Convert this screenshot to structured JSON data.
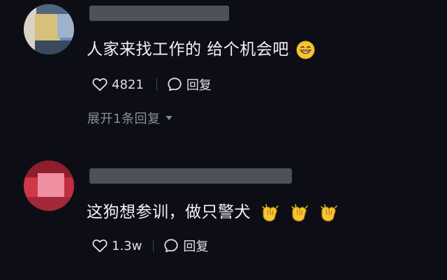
{
  "comments": [
    {
      "text": "人家来找工作的 给个机会吧",
      "emoji_icons": [
        "grinning-face-icon"
      ],
      "like_count": "4821",
      "reply_label": "回复",
      "expand_replies_label": "展开1条回复"
    },
    {
      "text": "这狗想参训，做只警犬",
      "emoji_icons": [
        "clapping-hands-icon",
        "clapping-hands-icon",
        "clapping-hands-icon"
      ],
      "like_count": "1.3w",
      "reply_label": "回复"
    }
  ],
  "colors": {
    "background": "#0d0e15",
    "text_primary": "#f2f3f6",
    "text_secondary": "#8c8f99",
    "emoji_yellow": "#f7c531"
  }
}
